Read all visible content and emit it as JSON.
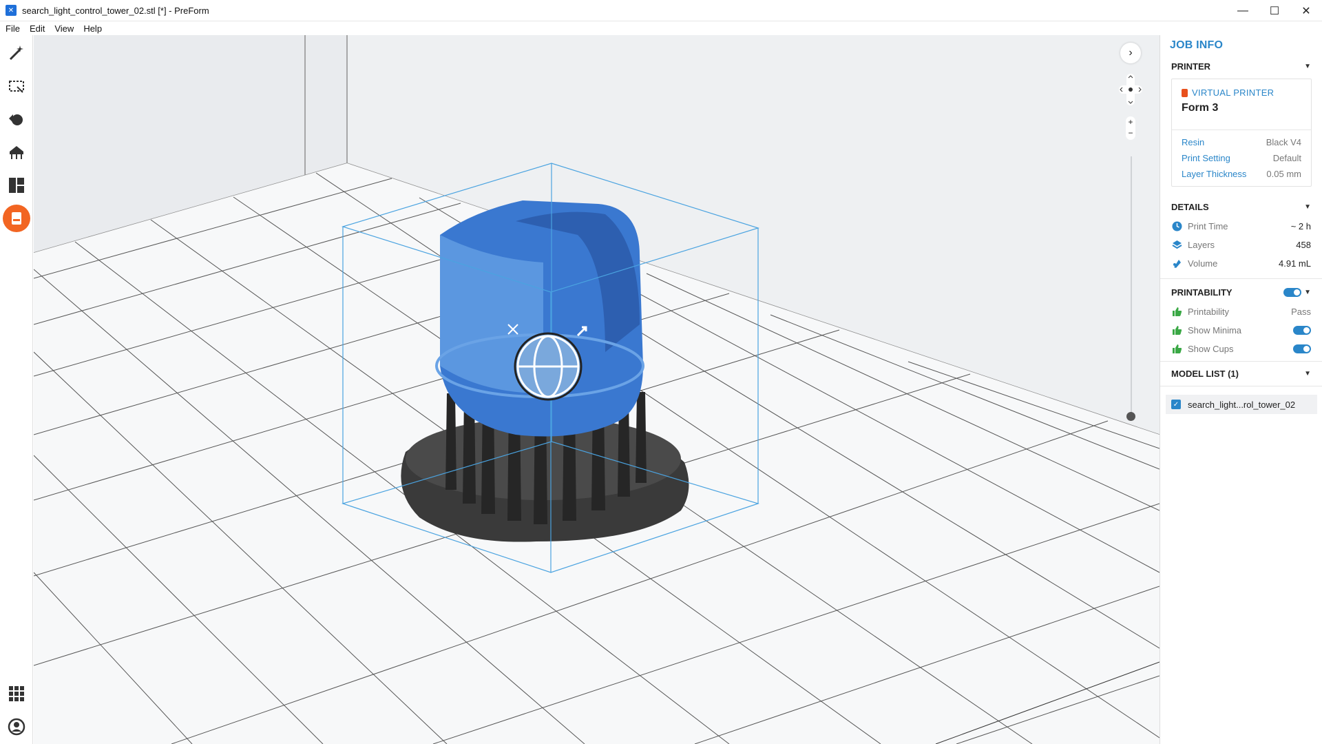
{
  "window": {
    "title": "search_light_control_tower_02.stl [*] - PreForm",
    "minimize": "—",
    "maximize": "☐",
    "close": "✕"
  },
  "menu": [
    "File",
    "Edit",
    "View",
    "Help"
  ],
  "sidebar": {
    "job_info": "JOB INFO",
    "printer": {
      "header": "PRINTER",
      "virtual_label": "VIRTUAL PRINTER",
      "name": "Form 3",
      "rows": [
        {
          "key": "Resin",
          "value": "Black V4"
        },
        {
          "key": "Print Setting",
          "value": "Default"
        },
        {
          "key": "Layer Thickness",
          "value": "0.05 mm"
        }
      ]
    },
    "details": {
      "header": "DETAILS",
      "rows": [
        {
          "label": "Print Time",
          "value": "~ 2 h"
        },
        {
          "label": "Layers",
          "value": "458"
        },
        {
          "label": "Volume",
          "value": "4.91 mL"
        }
      ]
    },
    "printability": {
      "header": "PRINTABILITY",
      "rows": [
        {
          "label": "Printability",
          "value": "Pass"
        },
        {
          "label": "Show Minima",
          "value": ""
        },
        {
          "label": "Show Cups",
          "value": ""
        }
      ]
    },
    "model_list": {
      "header": "MODEL LIST (1)",
      "items": [
        "search_light...rol_tower_02"
      ]
    }
  },
  "colors": {
    "accent": "#2a86c9",
    "active_tool": "#f26522",
    "model_blue": "#3a78d0",
    "support_black": "#2b2b2b"
  }
}
